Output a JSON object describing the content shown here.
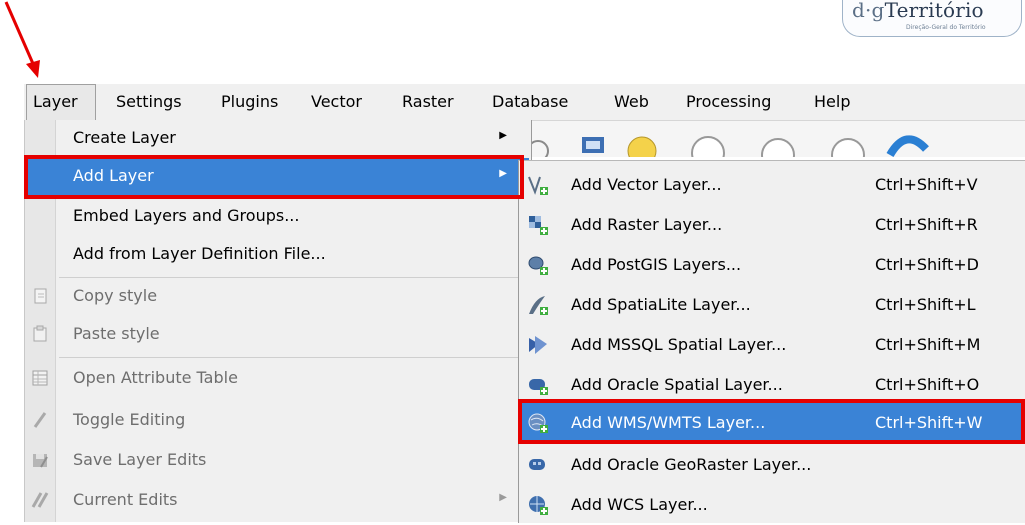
{
  "logo": {
    "brand_prefix": "d·g",
    "brand_name": "Território",
    "subtitle": "Direção-Geral do Território"
  },
  "menubar": {
    "items": [
      {
        "label": "Layer"
      },
      {
        "label": "Settings"
      },
      {
        "label": "Plugins"
      },
      {
        "label": "Vector"
      },
      {
        "label": "Raster"
      },
      {
        "label": "Database"
      },
      {
        "label": "Web"
      },
      {
        "label": "Processing"
      },
      {
        "label": "Help"
      }
    ],
    "active": "Layer"
  },
  "layer_menu": {
    "items": [
      {
        "label": "Create Layer",
        "submenu": true,
        "enabled": true,
        "icon": ""
      },
      {
        "label": "Add Layer",
        "submenu": true,
        "enabled": true,
        "highlighted": true,
        "icon": ""
      },
      {
        "label": "Embed Layers and Groups...",
        "enabled": true,
        "icon": ""
      },
      {
        "label": "Add from Layer Definition File...",
        "enabled": true,
        "icon": ""
      },
      {
        "label": "Copy style",
        "enabled": false,
        "icon": "copy-style-icon"
      },
      {
        "label": "Paste style",
        "enabled": false,
        "icon": "paste-style-icon"
      },
      {
        "label": "Open Attribute Table",
        "enabled": false,
        "icon": "attribute-table-icon"
      },
      {
        "label": "Toggle Editing",
        "enabled": false,
        "icon": "pencil-icon"
      },
      {
        "label": "Save Layer Edits",
        "enabled": false,
        "icon": "save-edits-icon"
      },
      {
        "label": "Current Edits",
        "enabled": false,
        "submenu": true,
        "icon": "current-edits-icon"
      }
    ]
  },
  "add_layer_submenu": {
    "items": [
      {
        "label": "Add Vector Layer...",
        "shortcut": "Ctrl+Shift+V",
        "icon": "vector-layer-icon"
      },
      {
        "label": "Add Raster Layer...",
        "shortcut": "Ctrl+Shift+R",
        "icon": "raster-layer-icon"
      },
      {
        "label": "Add PostGIS Layers...",
        "shortcut": "Ctrl+Shift+D",
        "icon": "postgis-icon"
      },
      {
        "label": "Add SpatiaLite Layer...",
        "shortcut": "Ctrl+Shift+L",
        "icon": "spatialite-icon"
      },
      {
        "label": "Add MSSQL Spatial Layer...",
        "shortcut": "Ctrl+Shift+M",
        "icon": "mssql-icon"
      },
      {
        "label": "Add Oracle Spatial Layer...",
        "shortcut": "Ctrl+Shift+O",
        "icon": "oracle-icon"
      },
      {
        "label": "Add WMS/WMTS Layer...",
        "shortcut": "Ctrl+Shift+W",
        "icon": "wms-icon",
        "highlighted": true
      },
      {
        "label": "Add Oracle GeoRaster Layer...",
        "shortcut": "",
        "icon": "georaster-icon"
      },
      {
        "label": "Add WCS Layer...",
        "shortcut": "",
        "icon": "wcs-icon"
      }
    ]
  },
  "colors": {
    "highlight": "#3a83d6",
    "annotation_red": "#e50000"
  }
}
